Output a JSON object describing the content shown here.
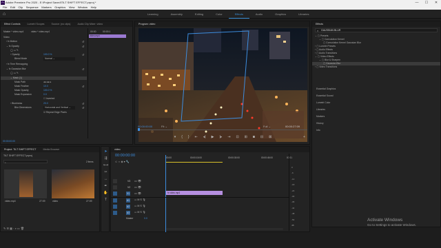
{
  "window": {
    "title": "Adobe Premiere Pro 2020 - E:\\Project Saved\\TILT SHIFT EFFECT.prproj *",
    "min": "—",
    "max": "☐",
    "close": "✕"
  },
  "menu": [
    "File",
    "Edit",
    "Clip",
    "Sequence",
    "Markers",
    "Graphics",
    "View",
    "Window",
    "Help"
  ],
  "workspaces": [
    "Learning",
    "Assembly",
    "Editing",
    "Color",
    "Effects",
    "Audio",
    "Graphics",
    "Libraries"
  ],
  "active_workspace": "Effects",
  "effect_controls": {
    "tabs": [
      "Effect Controls",
      "Lumetri Scopes",
      "Source: (no clips)",
      "Audio Clip Mixer: video"
    ],
    "source_line": "Master * video.mp4",
    "seq_line": "video * video.mp4",
    "time_ruler": "00:00",
    "time_ruler2": "00:00:1",
    "clip_label": "video.mp4",
    "section": "Video",
    "rows": [
      {
        "label": "Motion",
        "value": ""
      },
      {
        "label": "Opacity",
        "value": ""
      },
      {
        "label": "Opacity",
        "value": "100.0 %"
      },
      {
        "label": "Blend Mode",
        "value": "Normal"
      },
      {
        "label": "Time Remapping",
        "value": ""
      },
      {
        "label": "Gaussian Blur",
        "value": ""
      },
      {
        "label": "Mask (1)",
        "value": ""
      },
      {
        "label": "Mask Path",
        "value": ""
      },
      {
        "label": "Mask Feather",
        "value": "10.0"
      },
      {
        "label": "Mask Opacity",
        "value": "100.0 %"
      },
      {
        "label": "Mask Expansion",
        "value": "0.0"
      },
      {
        "label": "",
        "value": "Inverted"
      },
      {
        "label": "Blurriness",
        "value": "20.0"
      },
      {
        "label": "Blur Dimensions",
        "value": "Horizontal and Vertical"
      },
      {
        "label": "",
        "value": "Repeat Edge Pixels"
      }
    ],
    "timecode": "00:00:00:00"
  },
  "program": {
    "tab": "Program: video",
    "timecode_left": "00:00:00:00",
    "fit": "Fit",
    "full": "Full",
    "timecode_right": "00:00:27:09",
    "controls": [
      "⏮",
      "{",
      "}",
      "⇤",
      "◀",
      "▶",
      "▶",
      "⇥",
      "⊡",
      "⊞",
      "📷",
      "⊟",
      "⊠"
    ]
  },
  "effects": {
    "tab": "Effects",
    "search": "GAUSSIAN BLUR",
    "tree": [
      {
        "label": "Presets",
        "indent": 0
      },
      {
        "label": "Convolution Kernel",
        "indent": 1
      },
      {
        "label": "Convolution Kernel Gaussian Blur",
        "indent": 2
      },
      {
        "label": "Lumetri Presets",
        "indent": 0
      },
      {
        "label": "Audio Effects",
        "indent": 0
      },
      {
        "label": "Audio Transitions",
        "indent": 0
      },
      {
        "label": "Video Effects",
        "indent": 0
      },
      {
        "label": "Blur & Sharpen",
        "indent": 1
      },
      {
        "label": "Gaussian Blur",
        "indent": 2
      },
      {
        "label": "Video Transitions",
        "indent": 0
      }
    ],
    "sections": [
      "Essential Graphics",
      "Essential Sound",
      "Lumetri Color",
      "Libraries",
      "Markers",
      "History",
      "Info"
    ]
  },
  "project": {
    "tabs": [
      "Project: TILT SHIFT EFFECT",
      "Media Browser"
    ],
    "file": "TILT SHIFT EFFECT.prproj",
    "count": "2 Items",
    "items": [
      {
        "name": "video.mp4",
        "dur": "27:09"
      },
      {
        "name": "video",
        "dur": "27:09"
      }
    ]
  },
  "timeline": {
    "tab": "video",
    "timecode": "00:00:00:00",
    "ruler": [
      "00:00",
      "00:00:15:00",
      "00:00:30:00",
      "00:00:45:00",
      "00:01"
    ],
    "video_tracks": [
      "V3",
      "V2",
      "V1"
    ],
    "audio_tracks": [
      "A1",
      "A2",
      "A3"
    ],
    "master": "Master",
    "master_val": "0.0",
    "clip": "video.mp4",
    "meter": [
      "0",
      "-6",
      "-12",
      "-18",
      "-24",
      "-30",
      "-36",
      "-42",
      "-48",
      "-54",
      "dB"
    ]
  },
  "activation": {
    "title": "Activate Windows",
    "sub": "Go to Settings to activate Windows."
  }
}
